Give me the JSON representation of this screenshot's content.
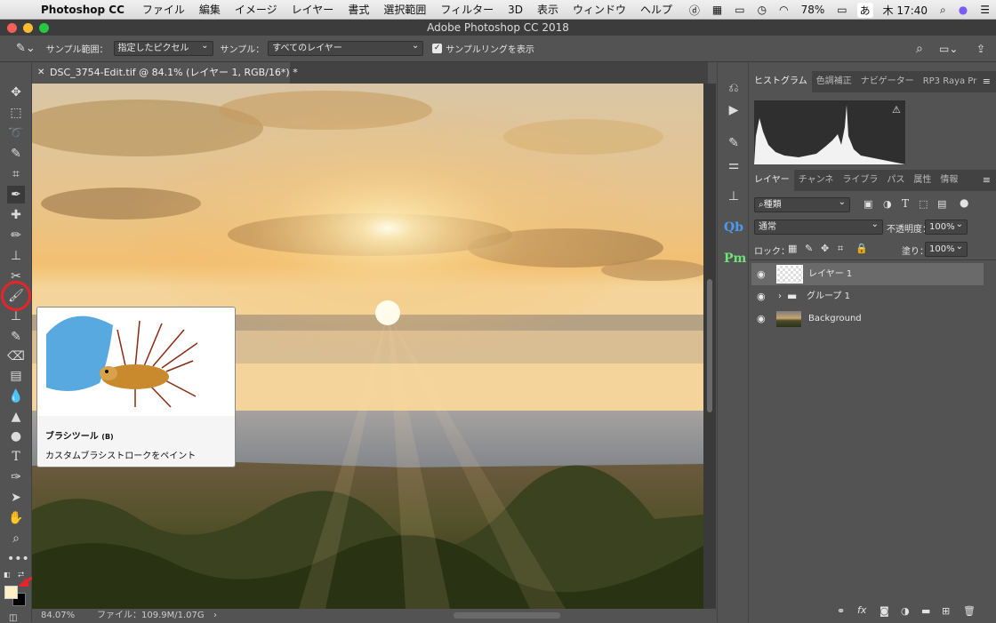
{
  "menubar": {
    "app": "Photoshop CC",
    "items": [
      "ファイル",
      "編集",
      "イメージ",
      "レイヤー",
      "書式",
      "選択範囲",
      "フィルター",
      "3D",
      "表示",
      "ウィンドウ",
      "ヘルプ"
    ],
    "battery": "78%",
    "ime": "あ",
    "clock": "木 17:40"
  },
  "window": {
    "title": "Adobe Photoshop CC 2018"
  },
  "options": {
    "sample_size_label": "サンプル範囲：",
    "sample_size_value": "指定したピクセル",
    "sample_label": "サンプル：",
    "sample_value": "すべてのレイヤー",
    "show_ring_label": "サンプルリングを表示"
  },
  "document": {
    "tab_title": "DSC_3754-Edit.tif @ 84.1% (レイヤー 1, RGB/16*) *"
  },
  "status": {
    "zoom": "84.07%",
    "file_info": "ファイル：109.9M/1.07G"
  },
  "tooltip": {
    "title": "ブラシツール",
    "shortcut": "(B)",
    "description": "カスタムブラシストロークをペイント"
  },
  "histogram_panel": {
    "tabs": [
      "ヒストグラム",
      "色調補正",
      "ナビゲーター",
      "RP3 Raya Pr"
    ]
  },
  "layers_panel": {
    "tabs": [
      "レイヤー",
      "チャンネ",
      "ライブラ",
      "パス",
      "属性",
      "情報"
    ],
    "filter_value": "種類",
    "blend_mode": "通常",
    "opacity_label": "不透明度：",
    "opacity_value": "100%",
    "lock_label": "ロック：",
    "fill_label": "塗り：",
    "fill_value": "100%",
    "layers": [
      {
        "name": "レイヤー 1"
      },
      {
        "name": "グループ 1"
      },
      {
        "name": "Background"
      }
    ]
  },
  "colors": {
    "foreground": "#fdf0c4",
    "background": "#000000",
    "highlight": "#e8242b"
  }
}
